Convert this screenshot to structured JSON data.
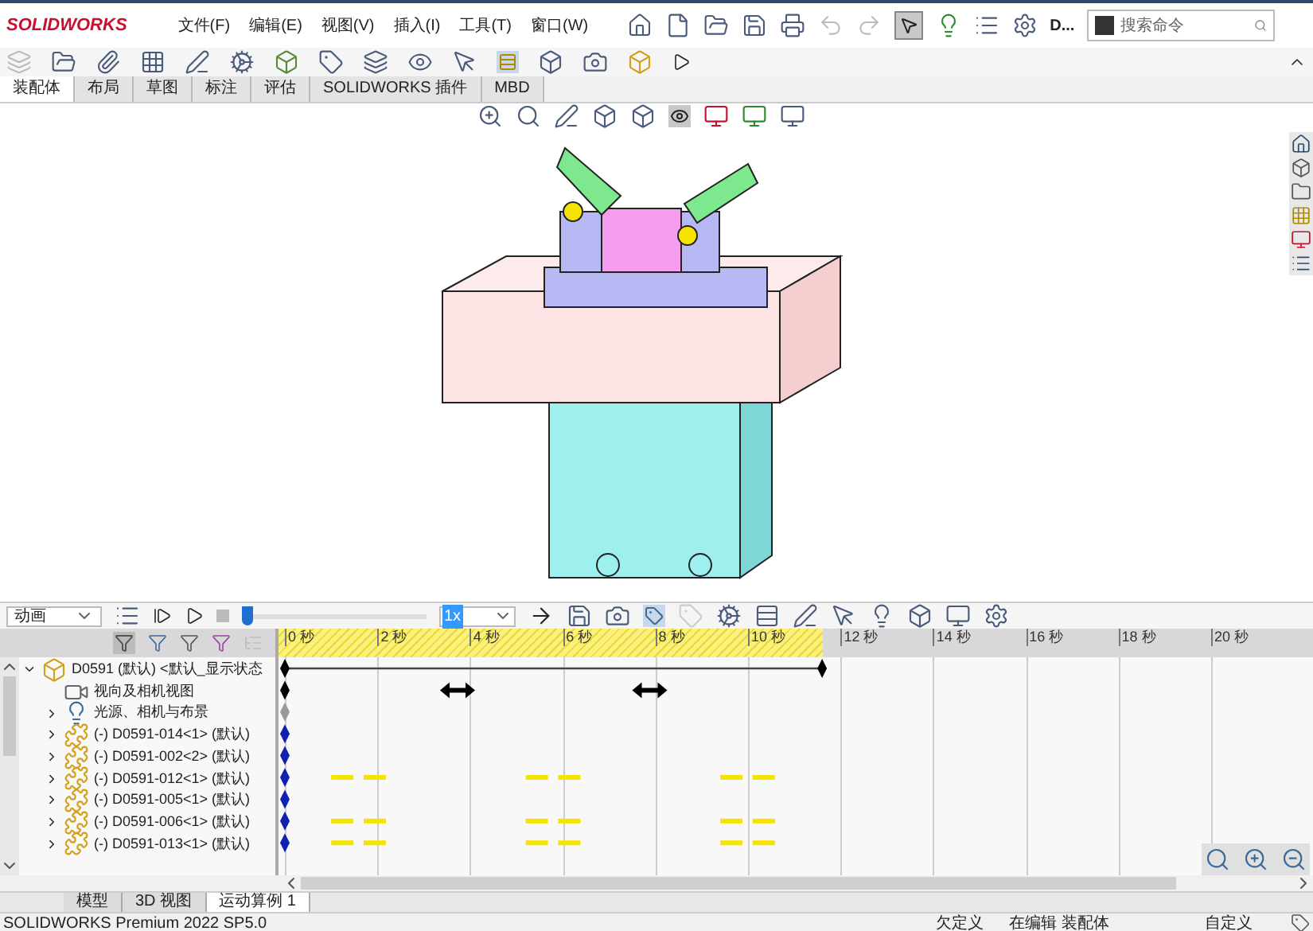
{
  "app": {
    "logo": "SOLIDWORKS",
    "menus": [
      "文件(F)",
      "编辑(E)",
      "视图(V)",
      "插入(I)",
      "工具(T)",
      "窗口(W)"
    ],
    "doc_label": "D...",
    "search": {
      "placeholder": "搜索命令"
    }
  },
  "tabs": [
    {
      "label": "装配体",
      "selected": true
    },
    {
      "label": "布局",
      "selected": false
    },
    {
      "label": "草图",
      "selected": false
    },
    {
      "label": "标注",
      "selected": false
    },
    {
      "label": "评估",
      "selected": false
    },
    {
      "label": "SOLIDWORKS 插件",
      "selected": false
    },
    {
      "label": "MBD",
      "selected": false
    }
  ],
  "motion": {
    "study_type": "动画",
    "playback": {
      "level": 0
    },
    "speed": "1x",
    "ruler": [
      "0 秒",
      "2 秒",
      "4 秒",
      "6 秒",
      "8 秒",
      "10 秒",
      "12 秒",
      "14 秒",
      "16 秒",
      "18 秒",
      "20 秒"
    ],
    "tree": [
      {
        "label": "D0591 (默认) <默认_显示状态",
        "kind": "assembly",
        "expanded": true,
        "children": [
          {
            "label": "视向及相机视图",
            "kind": "camera"
          },
          {
            "label": "光源、相机与布景",
            "kind": "lights",
            "expanded": false
          },
          {
            "label": "(-) D0591-014<1> (默认)",
            "kind": "part",
            "expanded": false
          },
          {
            "label": "(-) D0591-002<2> (默认)",
            "kind": "part",
            "expanded": false
          },
          {
            "label": "(-) D0591-012<1> (默认)",
            "kind": "part",
            "expanded": false
          },
          {
            "label": "(-) D0591-005<1> (默认)",
            "kind": "part",
            "expanded": false
          },
          {
            "label": "(-) D0591-006<1> (默认)",
            "kind": "part",
            "expanded": false
          },
          {
            "label": "(-) D0591-013<1> (默认)",
            "kind": "part",
            "expanded": false
          }
        ]
      }
    ]
  },
  "bottom_tabs": [
    {
      "label": "模型",
      "selected": false
    },
    {
      "label": "3D 视图",
      "selected": false
    },
    {
      "label": "运动算例 1",
      "selected": true
    }
  ],
  "status_bar": {
    "product": "SOLIDWORKS Premium 2022 SP5.0",
    "state": "欠定义",
    "mode": "在编辑 装配体",
    "units": "自定义"
  }
}
